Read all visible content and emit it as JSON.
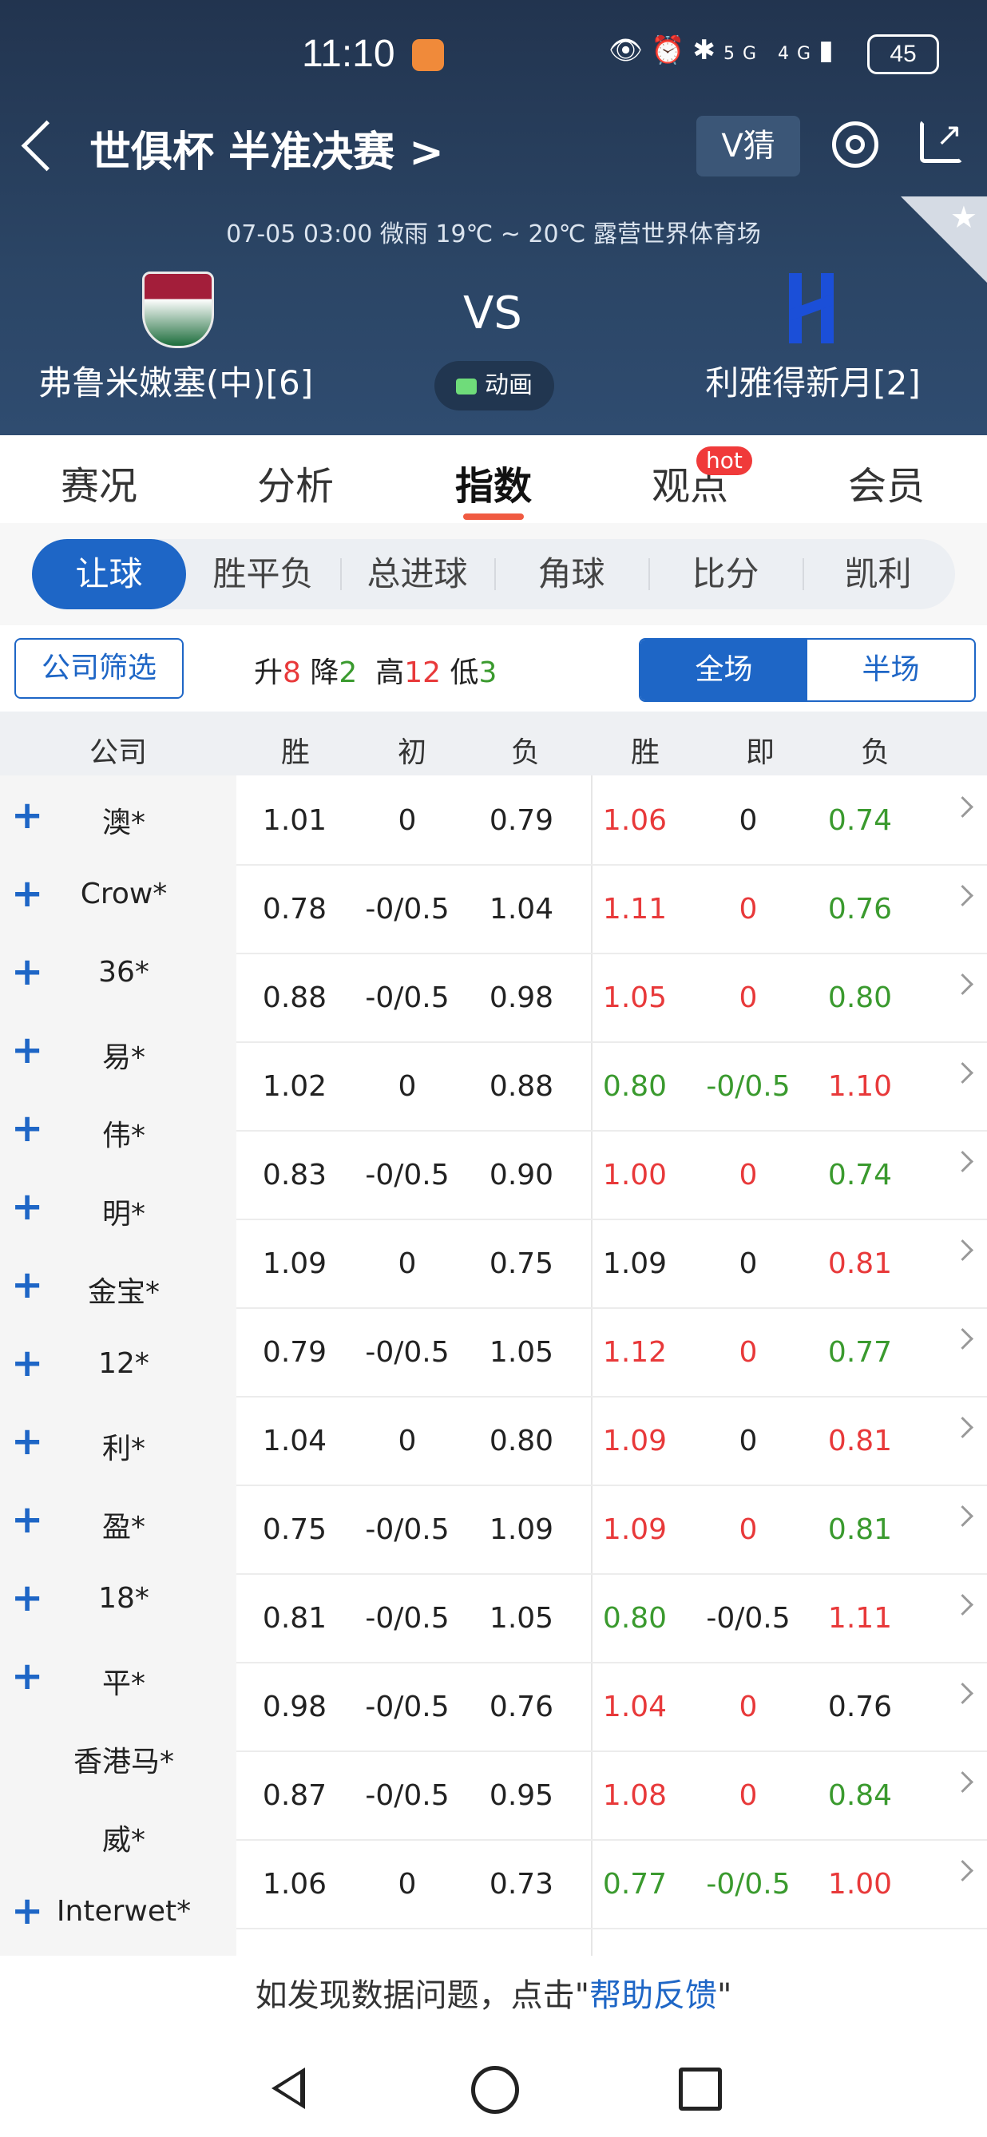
{
  "status_bar": {
    "time": "11:10",
    "network": "5G 4G",
    "battery": "45"
  },
  "header": {
    "title": "世俱杯 半准决赛 >",
    "v_guess": "V猜",
    "match_info": "07-05 03:00   微雨 19℃ ~ 20℃   露营世界体育场",
    "vs": "VS",
    "animation_label": "动画",
    "home_team": "弗鲁米嫩塞(中)[6]",
    "away_team": "利雅得新月[2]"
  },
  "tabs": [
    {
      "label": "赛况"
    },
    {
      "label": "分析"
    },
    {
      "label": "指数"
    },
    {
      "label": "观点",
      "badge": "hot"
    },
    {
      "label": "会员"
    }
  ],
  "subtabs": [
    "让球",
    "胜平负",
    "总进球",
    "角球",
    "比分",
    "凯利"
  ],
  "filter": {
    "company_filter": "公司筛选",
    "up_label": "升",
    "up": "8",
    "down_label": "降",
    "down": "2",
    "high_label": "高",
    "high": "12",
    "low_label": "低",
    "low": "3",
    "full": "全场",
    "half": "半场"
  },
  "table": {
    "headers": [
      "公司",
      "胜",
      "初",
      "负",
      "胜",
      "即",
      "负"
    ],
    "companies": [
      {
        "name": "澳*",
        "plus": true
      },
      {
        "name": "Crow*",
        "plus": true
      },
      {
        "name": "36*",
        "plus": true
      },
      {
        "name": "易*",
        "plus": true
      },
      {
        "name": "伟*",
        "plus": true
      },
      {
        "name": "明*",
        "plus": true
      },
      {
        "name": "金宝*",
        "plus": true
      },
      {
        "name": "12*",
        "plus": true
      },
      {
        "name": "利*",
        "plus": true
      },
      {
        "name": "盈*",
        "plus": true
      },
      {
        "name": "18*",
        "plus": true
      },
      {
        "name": "平*",
        "plus": true
      },
      {
        "name": "香港马*",
        "plus": false
      },
      {
        "name": "威*",
        "plus": false
      },
      {
        "name": "Interwet*",
        "plus": true
      }
    ],
    "rows": [
      [
        [
          "1.01",
          "n"
        ],
        [
          "0",
          "n"
        ],
        [
          "0.79",
          "n"
        ],
        [
          "1.06",
          "r"
        ],
        [
          "0",
          "n"
        ],
        [
          "0.74",
          "g"
        ]
      ],
      [
        [
          "0.78",
          "n"
        ],
        [
          "-0/0.5",
          "n"
        ],
        [
          "1.04",
          "n"
        ],
        [
          "1.11",
          "r"
        ],
        [
          "0",
          "r"
        ],
        [
          "0.76",
          "g"
        ]
      ],
      [
        [
          "0.88",
          "n"
        ],
        [
          "-0/0.5",
          "n"
        ],
        [
          "0.98",
          "n"
        ],
        [
          "1.05",
          "r"
        ],
        [
          "0",
          "r"
        ],
        [
          "0.80",
          "g"
        ]
      ],
      [
        [
          "1.02",
          "n"
        ],
        [
          "0",
          "n"
        ],
        [
          "0.88",
          "n"
        ],
        [
          "0.80",
          "g"
        ],
        [
          "-0/0.5",
          "g"
        ],
        [
          "1.10",
          "r"
        ]
      ],
      [
        [
          "0.83",
          "n"
        ],
        [
          "-0/0.5",
          "n"
        ],
        [
          "0.90",
          "n"
        ],
        [
          "1.00",
          "r"
        ],
        [
          "0",
          "r"
        ],
        [
          "0.74",
          "g"
        ]
      ],
      [
        [
          "1.09",
          "n"
        ],
        [
          "0",
          "n"
        ],
        [
          "0.75",
          "n"
        ],
        [
          "1.09",
          "n"
        ],
        [
          "0",
          "n"
        ],
        [
          "0.81",
          "r"
        ]
      ],
      [
        [
          "0.79",
          "n"
        ],
        [
          "-0/0.5",
          "n"
        ],
        [
          "1.05",
          "n"
        ],
        [
          "1.12",
          "r"
        ],
        [
          "0",
          "r"
        ],
        [
          "0.77",
          "g"
        ]
      ],
      [
        [
          "1.04",
          "n"
        ],
        [
          "0",
          "n"
        ],
        [
          "0.80",
          "n"
        ],
        [
          "1.09",
          "r"
        ],
        [
          "0",
          "n"
        ],
        [
          "0.81",
          "r"
        ]
      ],
      [
        [
          "0.75",
          "n"
        ],
        [
          "-0/0.5",
          "n"
        ],
        [
          "1.09",
          "n"
        ],
        [
          "1.09",
          "r"
        ],
        [
          "0",
          "r"
        ],
        [
          "0.81",
          "g"
        ]
      ],
      [
        [
          "0.81",
          "n"
        ],
        [
          "-0/0.5",
          "n"
        ],
        [
          "1.05",
          "n"
        ],
        [
          "0.80",
          "g"
        ],
        [
          "-0/0.5",
          "n"
        ],
        [
          "1.11",
          "r"
        ]
      ],
      [
        [
          "0.98",
          "n"
        ],
        [
          "-0/0.5",
          "n"
        ],
        [
          "0.76",
          "n"
        ],
        [
          "1.04",
          "r"
        ],
        [
          "0",
          "r"
        ],
        [
          "0.76",
          "n"
        ]
      ],
      [
        [
          "0.87",
          "n"
        ],
        [
          "-0/0.5",
          "n"
        ],
        [
          "0.95",
          "n"
        ],
        [
          "1.08",
          "r"
        ],
        [
          "0",
          "r"
        ],
        [
          "0.84",
          "g"
        ]
      ],
      [
        [
          "1.06",
          "n"
        ],
        [
          "0",
          "n"
        ],
        [
          "0.73",
          "n"
        ],
        [
          "0.77",
          "g"
        ],
        [
          "-0/0.5",
          "g"
        ],
        [
          "1.00",
          "r"
        ]
      ]
    ]
  },
  "footer": {
    "prefix": "如发现数据问题，点击\"",
    "link": "帮助反馈",
    "suffix": "\""
  },
  "colors": {
    "accent": "#1e66c6",
    "up": "#e8393a",
    "down": "#3a9a2e",
    "header_bg": "#2b4565",
    "tab_underline": "#f05a41"
  }
}
